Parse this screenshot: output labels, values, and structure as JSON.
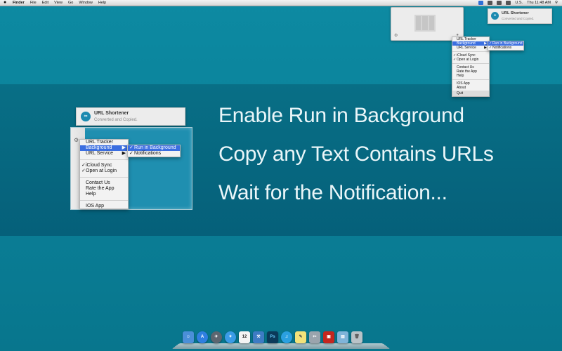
{
  "menubar": {
    "apple": "",
    "menus": [
      "Finder",
      "File",
      "Edit",
      "View",
      "Go",
      "Window",
      "Help"
    ],
    "status": {
      "icons": [
        "app-icon",
        "wifi-icon",
        "volume-icon",
        "flag-icon",
        "search-icon"
      ],
      "locale": "U.S.",
      "clock": "Thu 11:48 AM"
    }
  },
  "notification": {
    "title": "URL Shortener",
    "subtitle": "Converted and Copied."
  },
  "menu": {
    "items": [
      {
        "label": "URL Tracker",
        "checked": false,
        "submenu": false
      },
      {
        "label": "Background",
        "checked": false,
        "submenu": true,
        "highlighted": true
      },
      {
        "label": "URL Service",
        "checked": false,
        "submenu": true
      }
    ],
    "group2": [
      {
        "label": "iCloud Sync",
        "checked": true
      },
      {
        "label": "Open at Login",
        "checked": true
      }
    ],
    "group3": [
      {
        "label": "Contact Us"
      },
      {
        "label": "Rate the App"
      },
      {
        "label": "Help"
      }
    ],
    "group4": [
      {
        "label": "IOS App"
      },
      {
        "label": "About"
      }
    ],
    "quit": "Quit",
    "submenu": [
      {
        "label": "Run in Background",
        "checked": true,
        "highlighted": true
      },
      {
        "label": "Notifications",
        "checked": true
      }
    ]
  },
  "headlines": [
    "Enable Run in Background",
    "Copy any Text Contains URLs",
    "Wait for the Notification..."
  ],
  "dock": {
    "calendar_day": "12",
    "photoshop": "Ps",
    "icons": [
      "finder-icon",
      "appstore-icon",
      "launchpad-icon",
      "safari-icon",
      "calendar-icon",
      "xcode-icon",
      "photoshop-icon",
      "itunes-icon",
      "stickies-icon",
      "utilities-icon",
      "photo-booth-icon",
      "downloads-folder-icon",
      "trash-icon"
    ]
  },
  "colors": {
    "background": "#0a7e96",
    "accent": "#3b6ee0"
  }
}
